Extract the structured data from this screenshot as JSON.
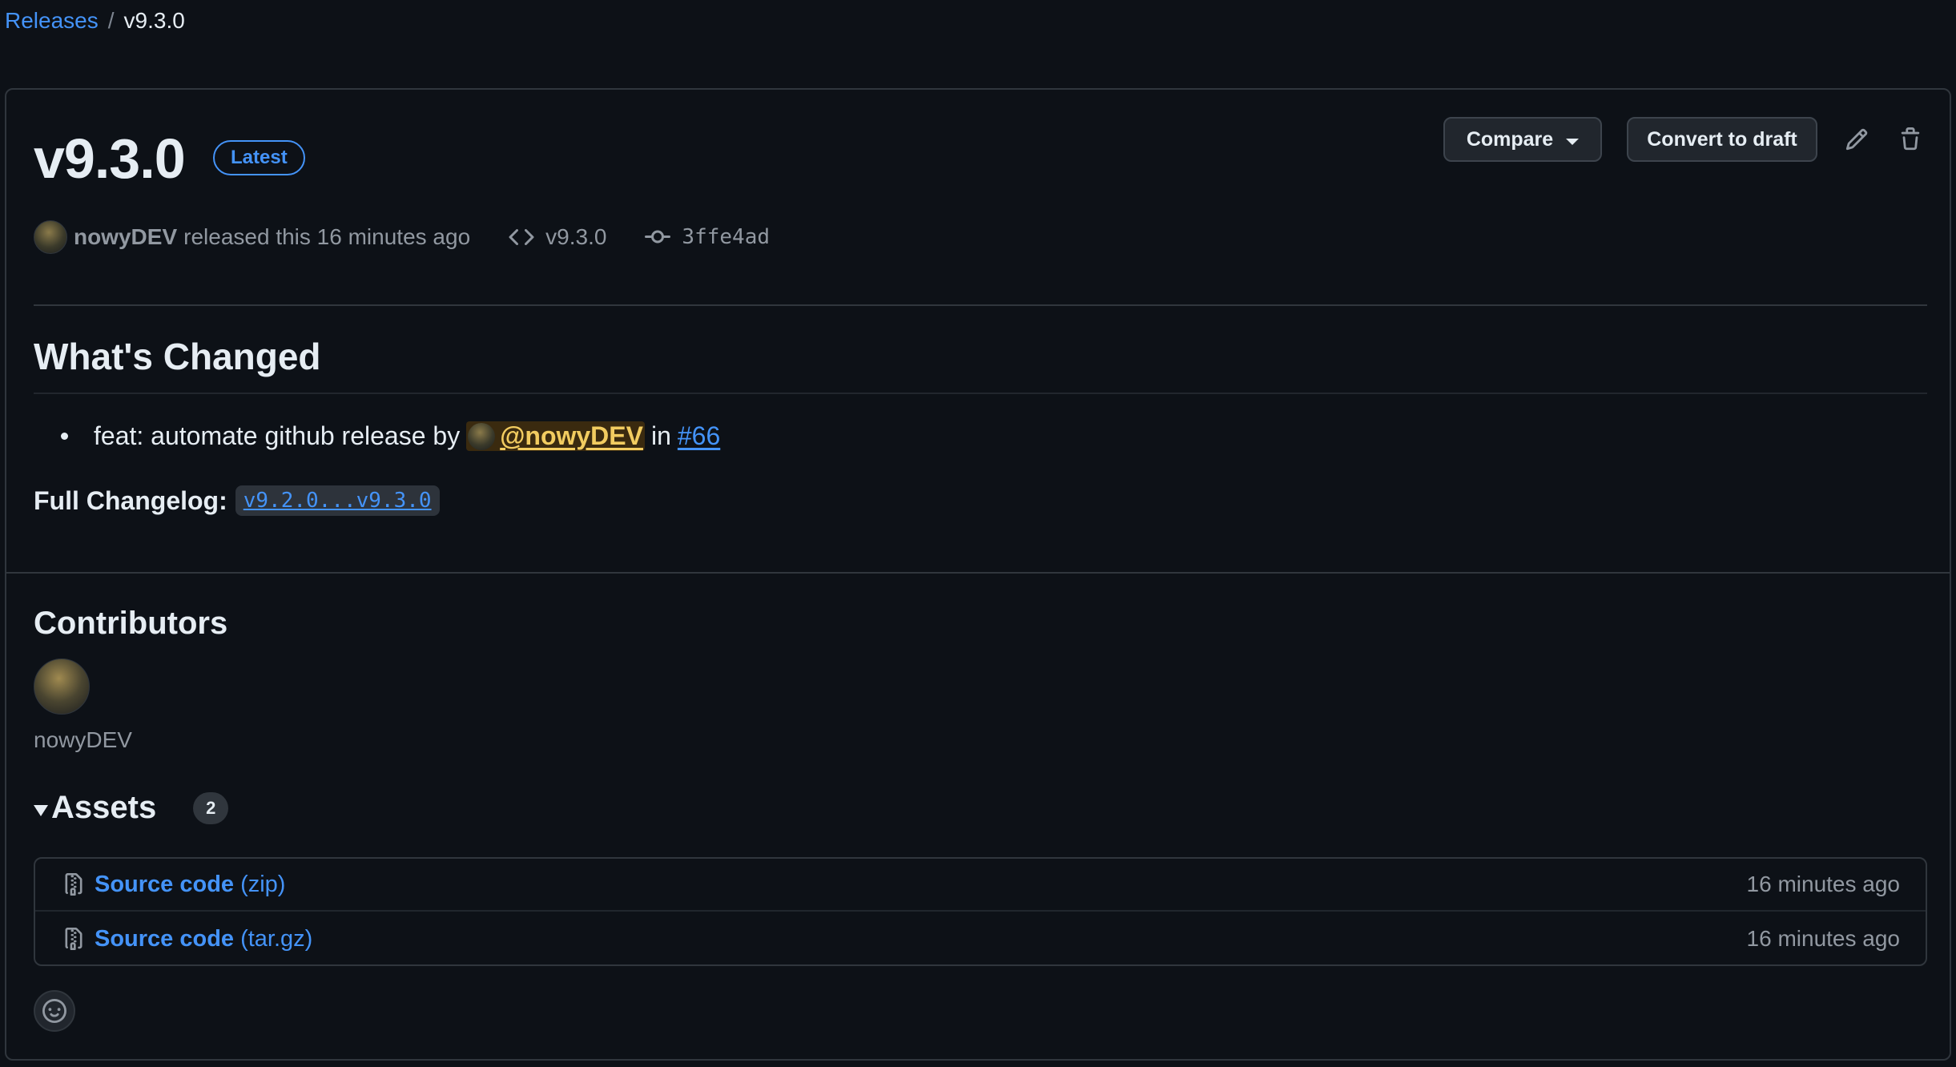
{
  "breadcrumb": {
    "parent": "Releases",
    "separator": "/",
    "current": "v9.3.0"
  },
  "release": {
    "title": "v9.3.0",
    "badge": "Latest",
    "author": "nowyDEV",
    "released_text": "released this 16 minutes ago",
    "tag": "v9.3.0",
    "commit": "3ffe4ad"
  },
  "toolbar": {
    "compare_label": "Compare",
    "draft_label": "Convert to draft"
  },
  "notes": {
    "heading": "What's Changed",
    "items": [
      {
        "text": "feat: automate github release by",
        "mention": "@nowyDEV",
        "in": "in",
        "issue": "#66"
      }
    ],
    "changelog_label": "Full Changelog:",
    "changelog_link": "v9.2.0...v9.3.0"
  },
  "contributors": {
    "heading": "Contributors",
    "names": [
      "nowyDEV"
    ]
  },
  "assets": {
    "heading": "Assets",
    "count": "2",
    "items": [
      {
        "name": "Source code",
        "ext": "(zip)",
        "time": "16 minutes ago"
      },
      {
        "name": "Source code",
        "ext": "(tar.gz)",
        "time": "16 minutes ago"
      }
    ]
  },
  "colors": {
    "background": "#0d1117",
    "accent": "#4493f8",
    "border": "#30363d",
    "mention": "#f2cc60"
  },
  "icons": [
    "code-icon",
    "commit-icon",
    "pencil-icon",
    "trash-icon",
    "file-zip-icon",
    "smiley-icon",
    "chevron-down-icon"
  ]
}
